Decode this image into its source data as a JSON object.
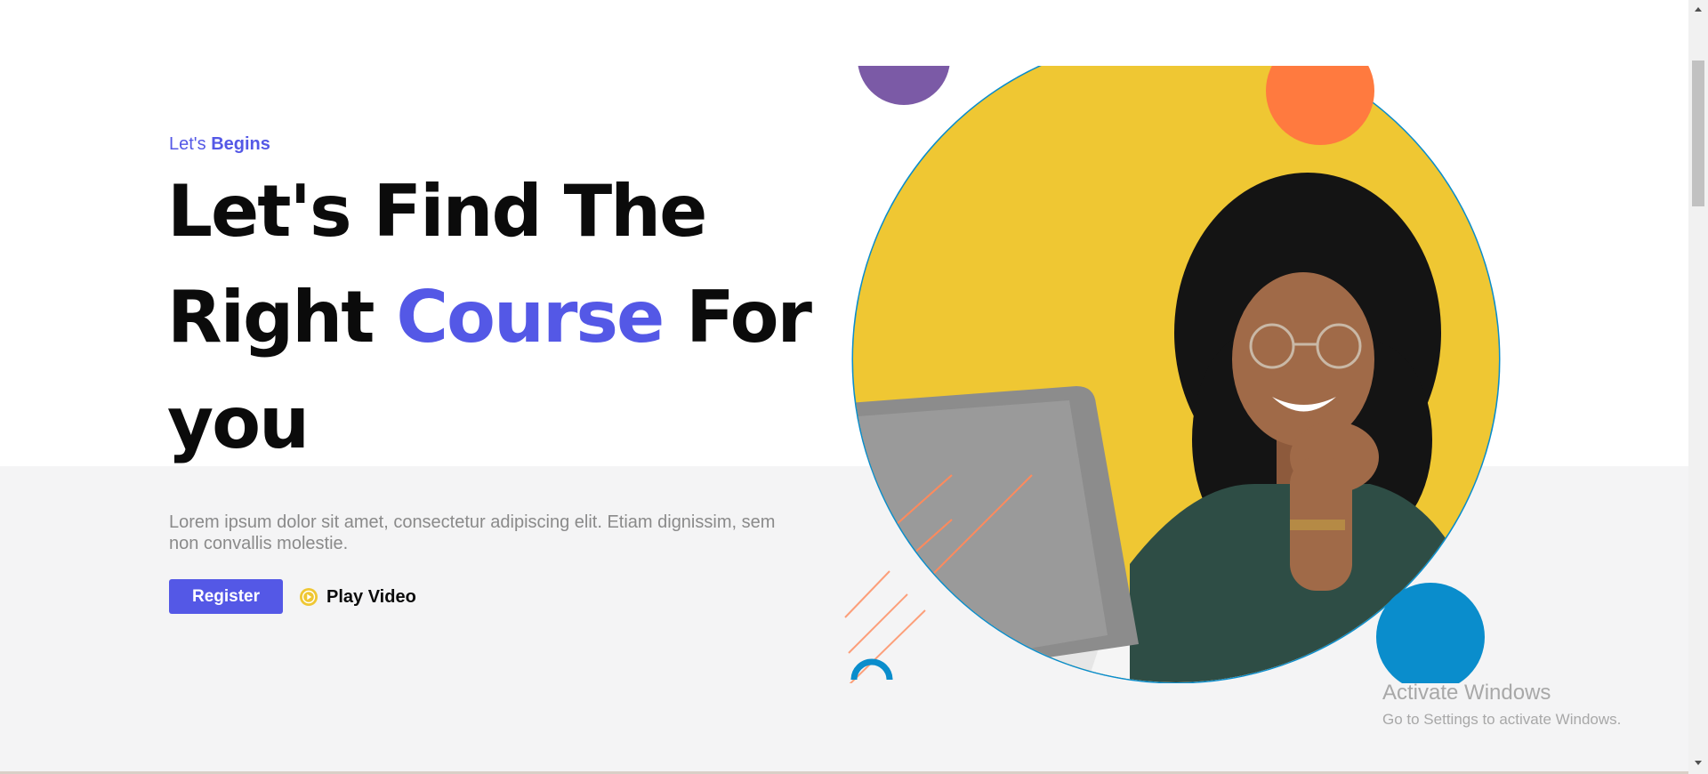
{
  "hero": {
    "eyebrow_prefix": "Let's",
    "eyebrow_emphasis": "Begins",
    "title_line1": "Let's Find The",
    "title_word_right": "Right",
    "title_accent": "Course",
    "title_word_for": "For",
    "title_line3": "you",
    "description": "Lorem ipsum dolor sit amet, consectetur adipiscing elit. Etiam dignissim, sem non convallis molestie.",
    "register_label": "Register",
    "play_label": "Play Video"
  },
  "watermark": {
    "title": "Activate Windows",
    "subtitle": "Go to Settings to activate Windows."
  },
  "icons": {
    "play": "play-circle-icon",
    "scroll_up": "chevron-up-icon",
    "scroll_down": "chevron-down-icon"
  },
  "colors": {
    "accent": "#5458e6",
    "yellow": "#efc733",
    "orange": "#ff7a3f",
    "purple": "#7b5aa6",
    "blue": "#0a8dcc",
    "section_gray": "#f4f4f5"
  }
}
